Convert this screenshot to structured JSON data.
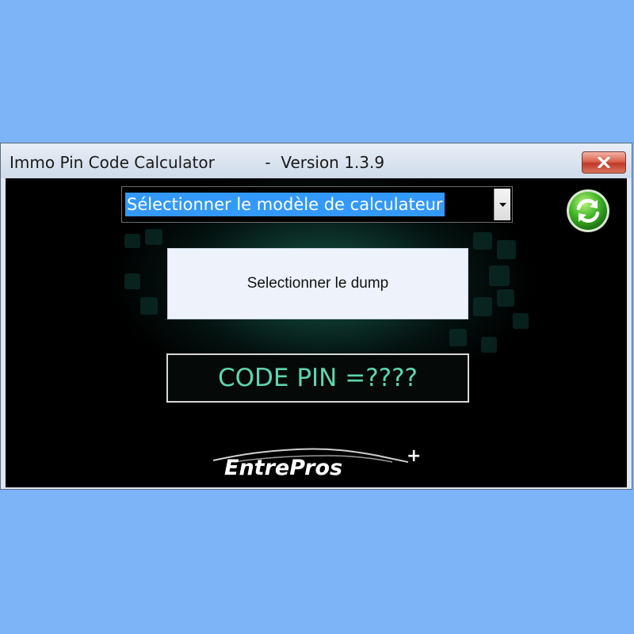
{
  "window": {
    "title": "Immo Pin Code Calculator",
    "separator": "-",
    "version": "Version 1.3.9"
  },
  "model_select": {
    "selected": "Sélectionner le modèle de calculateur"
  },
  "dump_button": {
    "label": "Selectionner le dump"
  },
  "pin": {
    "label": "CODE PIN =",
    "value": "????"
  },
  "logo": {
    "text": "EntrePros",
    "plus": "+"
  },
  "colors": {
    "desktop": "#7db4f8",
    "pin_text": "#5fd4b0",
    "selection": "#3399ff",
    "close_button": "#c0392b"
  },
  "icons": {
    "close": "close-icon",
    "refresh": "refresh-icon",
    "dropdown": "chevron-down-icon"
  }
}
